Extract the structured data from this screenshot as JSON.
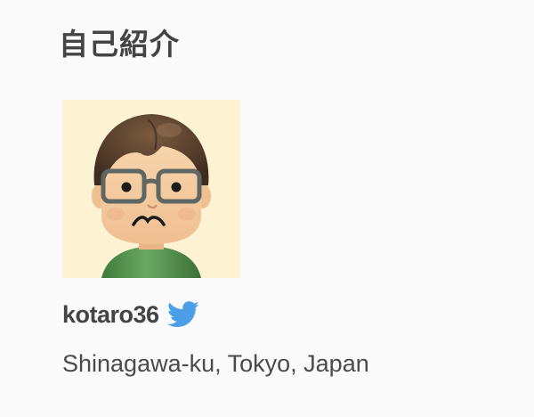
{
  "section": {
    "title": "自己紹介"
  },
  "profile": {
    "username": "kotaro36",
    "location": "Shinagawa-ku, Tokyo, Japan",
    "avatar_icon": "mii-avatar",
    "social_icon": "twitter-bird-icon"
  },
  "colors": {
    "twitter": "#4a9fe8",
    "avatar_bg": "#fdf3d2",
    "shirt": "#4f8f4a",
    "hair": "#4a3526"
  }
}
